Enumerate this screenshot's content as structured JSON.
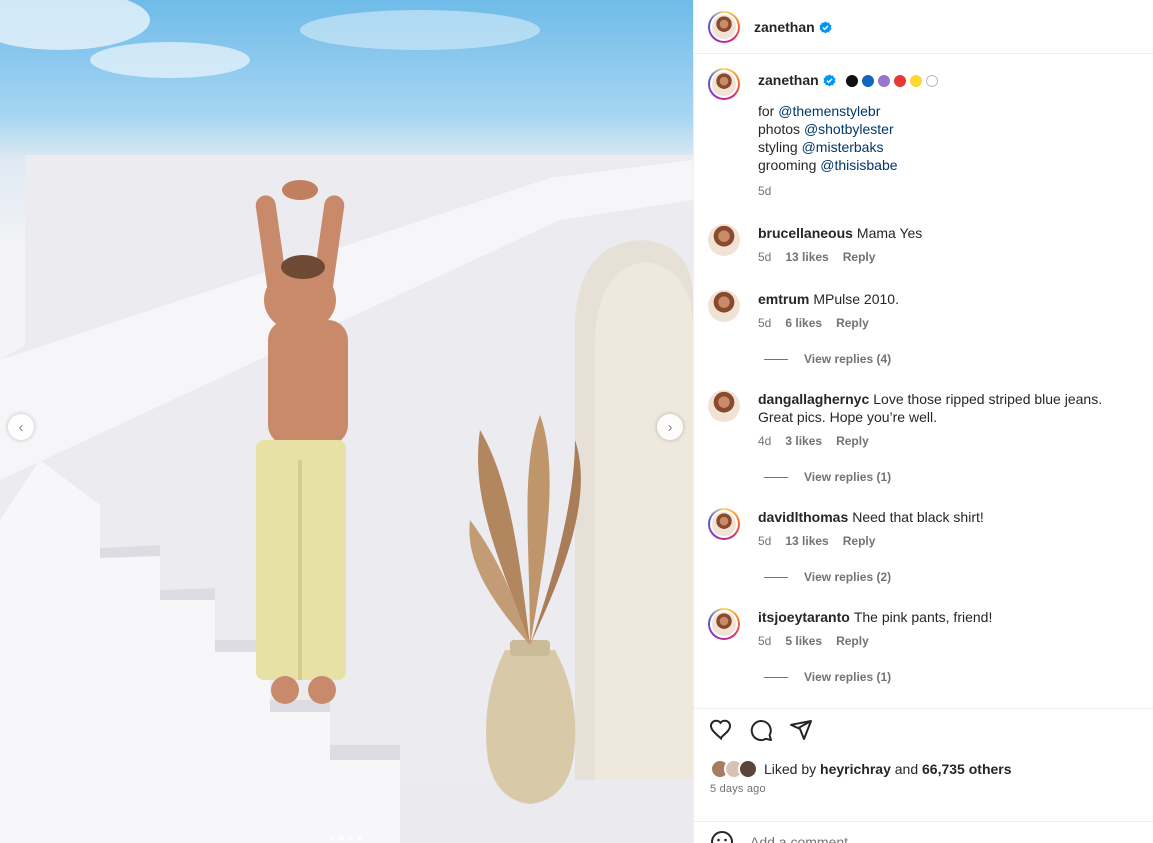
{
  "post": {
    "username": "zanethan",
    "verified": true,
    "caption": {
      "username": "zanethan",
      "emoji_dot_colors": [
        "#111111",
        "#1565c0",
        "#9575cd",
        "#e53935",
        "#fdd835",
        "#ffffff"
      ],
      "lines": [
        {
          "prefix": "for",
          "mention": "@themenstylebr"
        },
        {
          "prefix": "photos",
          "mention": "@shotbylester"
        },
        {
          "prefix": "styling",
          "mention": "@misterbaks"
        },
        {
          "prefix": "grooming",
          "mention": "@thisisbabe"
        }
      ],
      "age": "5d"
    },
    "comments": [
      {
        "username": "brucellaneous",
        "text": "Mama Yes",
        "age": "5d",
        "likes": "13 likes",
        "reply": "Reply",
        "view_replies": ""
      },
      {
        "username": "emtrum",
        "text": "MPulse 2010.",
        "age": "5d",
        "likes": "6 likes",
        "reply": "Reply",
        "view_replies": "View replies (4)"
      },
      {
        "username": "dangallaghernyc",
        "text": "Love those ripped striped blue jeans. Great pics. Hope you’re well.",
        "age": "4d",
        "likes": "3 likes",
        "reply": "Reply",
        "view_replies": "View replies (1)"
      },
      {
        "username": "davidlthomas",
        "text": "Need that black shirt!",
        "age": "5d",
        "likes": "13 likes",
        "reply": "Reply",
        "view_replies": "View replies (2)"
      },
      {
        "username": "itsjoeytaranto",
        "text": "The pink pants, friend!",
        "age": "5d",
        "likes": "5 likes",
        "reply": "Reply",
        "view_replies": "View replies (1)"
      }
    ],
    "liked_by": {
      "prefix": "Liked by",
      "user": "heyrichray",
      "joiner": "and",
      "others": "66,735 others"
    },
    "posted_ago": "5 days ago",
    "add_comment_placeholder": "Add a comment..."
  },
  "icons": {
    "like": "heart-icon",
    "comment": "comment-icon",
    "share": "share-icon",
    "emoji": "emoji-icon",
    "prev": "chevron-left-icon",
    "next": "chevron-right-icon",
    "verified": "verified-badge-icon"
  },
  "colors": {
    "mention": "#00376b",
    "verified": "#0095f6",
    "muted": "#737373"
  }
}
